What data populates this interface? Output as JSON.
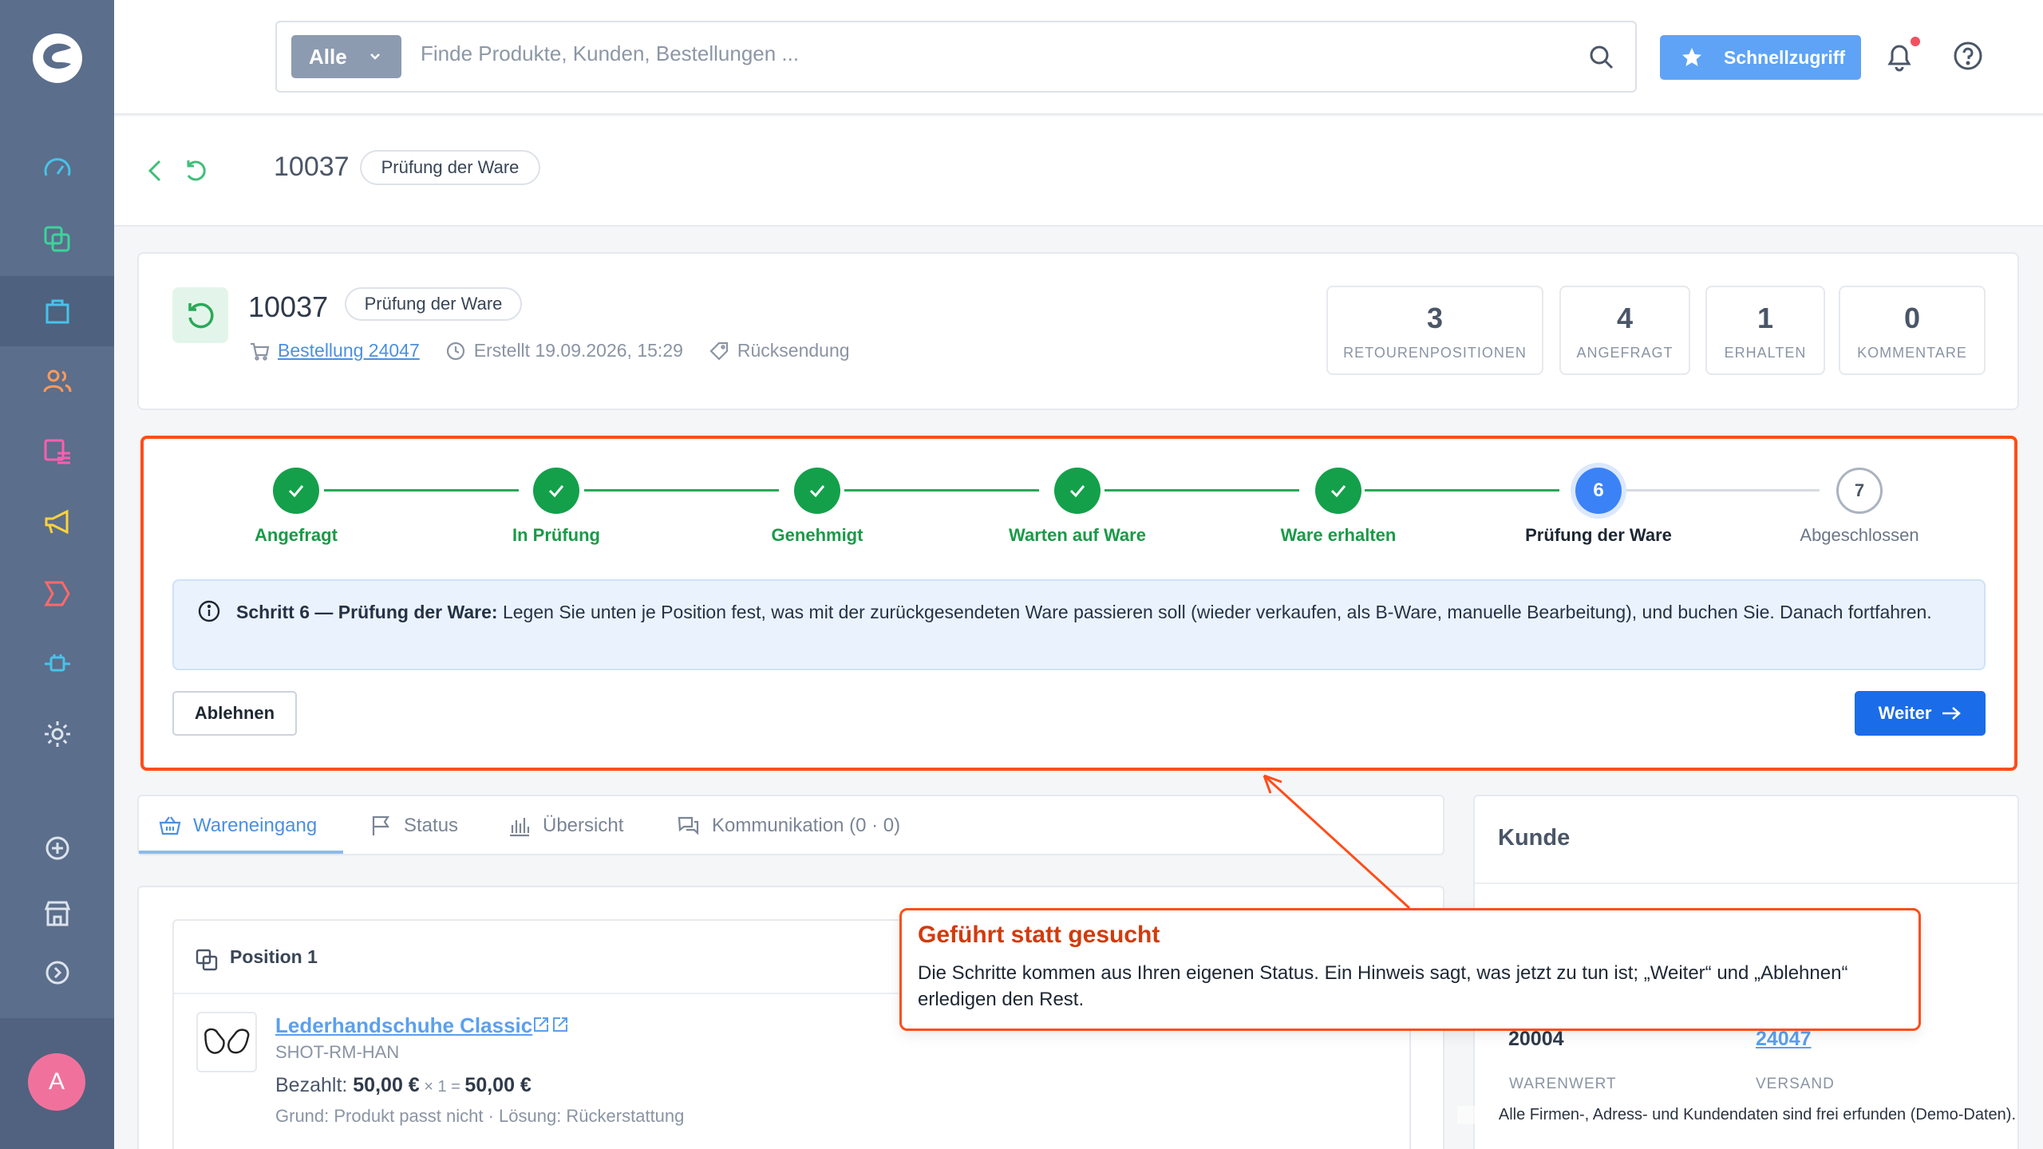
{
  "search": {
    "scope": "Alle",
    "placeholder": "Finde Produkte, Kunden, Bestellungen ..."
  },
  "topbar": {
    "quick_access": "Schnellzugriff"
  },
  "header": {
    "id": "10037",
    "status": "Prüfung der Ware"
  },
  "summary": {
    "id": "10037",
    "status": "Prüfung der Ware",
    "order_link": "Bestellung 24047",
    "created": "Erstellt 19.09.2026, 15:29",
    "type": "Rücksendung",
    "stats": [
      {
        "value": "3",
        "label": "RETOURENPOSITIONEN"
      },
      {
        "value": "4",
        "label": "ANGEFRAGT"
      },
      {
        "value": "1",
        "label": "ERHALTEN"
      },
      {
        "value": "0",
        "label": "KOMMENTARE"
      }
    ]
  },
  "steps": [
    {
      "label": "Angefragt",
      "state": "done"
    },
    {
      "label": "In Prüfung",
      "state": "done"
    },
    {
      "label": "Genehmigt",
      "state": "done"
    },
    {
      "label": "Warten auf Ware",
      "state": "done"
    },
    {
      "label": "Ware erhalten",
      "state": "done"
    },
    {
      "label": "Prüfung der Ware",
      "state": "current",
      "number": "6"
    },
    {
      "label": "Abgeschlossen",
      "state": "todo",
      "number": "7"
    }
  ],
  "hint": {
    "title": "Schritt 6 — Prüfung der Ware:",
    "text": " Legen Sie unten je Position fest, was mit der zurückgesendeten Ware passieren soll (wieder verkaufen, als B-Ware, manuelle Bearbeitung), und buchen Sie. Danach fortfahren."
  },
  "actions": {
    "reject": "Ablehnen",
    "next": "Weiter"
  },
  "tabs": [
    {
      "label": "Wareneingang"
    },
    {
      "label": "Status"
    },
    {
      "label": "Übersicht"
    },
    {
      "label": "Kommunikation (0 · 0)"
    }
  ],
  "position": {
    "title": "Position 1",
    "product": "Lederhandschuhe Classic",
    "sku": "SHOT-RM-HAN",
    "paid_label": "Bezahlt: ",
    "price": "50,00 €",
    "qty": " × 1 = ",
    "total": "50,00 €",
    "reason": "Grund: Produkt passt nicht · Lösung: Rückerstattung"
  },
  "customer": {
    "title": "Kunde",
    "number": "20004",
    "order": "24047",
    "label_value": "WARENWERT",
    "label_shipping": "VERSAND"
  },
  "callout": {
    "title": "Geführt statt gesucht",
    "text": "Die Schritte kommen aus Ihren eigenen Status. Ein Hinweis sagt, was jetzt zu tun ist; „Weiter“ und „Ablehnen“ erledigen den Rest."
  },
  "user": {
    "initial": "A"
  },
  "footnote": "Alle Firmen-, Adress- und Kundendaten sind frei erfunden (Demo-Daten).",
  "colors": {
    "accent": "#1a6ce8",
    "success": "#14a04a",
    "highlight": "#ff4d1a",
    "sidebar": "#5b6e8b"
  }
}
